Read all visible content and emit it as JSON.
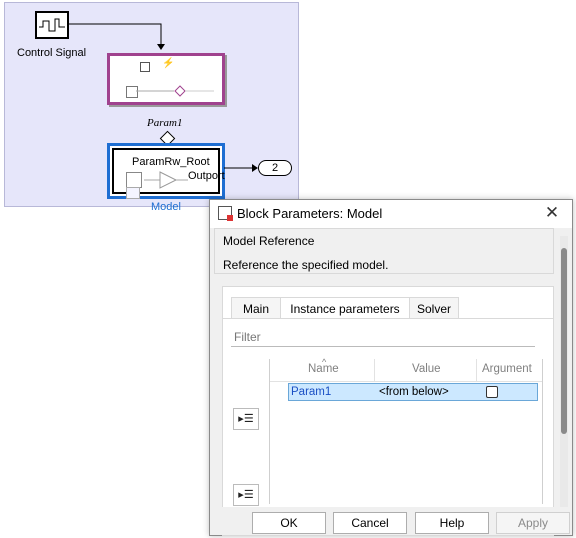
{
  "canvas": {
    "control_signal_label": "Control Signal",
    "param_label": "Param1",
    "model_block_title": "ParamRw_Root",
    "model_outport_label": "Outport",
    "model_name": "Model",
    "out_port_number": "2"
  },
  "dialog": {
    "title": "Block Parameters: Model",
    "close_glyph": "✕",
    "section_title": "Model Reference",
    "section_description": "Reference the specified model.",
    "tabs": [
      {
        "label": "Main",
        "active": false
      },
      {
        "label": "Instance parameters",
        "active": true
      },
      {
        "label": "Solver",
        "active": false
      }
    ],
    "filter_placeholder": "Filter",
    "table": {
      "columns": [
        "Name",
        "Value",
        "Argument"
      ],
      "sort_glyph": "^",
      "rows": [
        {
          "name": "Param1",
          "value": "<from below>",
          "argument": false
        }
      ]
    },
    "buttons": {
      "ok": "OK",
      "cancel": "Cancel",
      "help": "Help",
      "apply": "Apply"
    }
  },
  "colors": {
    "canvas_bg": "#e6e6fa",
    "subsystem_border": "#a0428e",
    "model_border": "#1e6ed2",
    "selection_bg": "#cce8ff"
  }
}
